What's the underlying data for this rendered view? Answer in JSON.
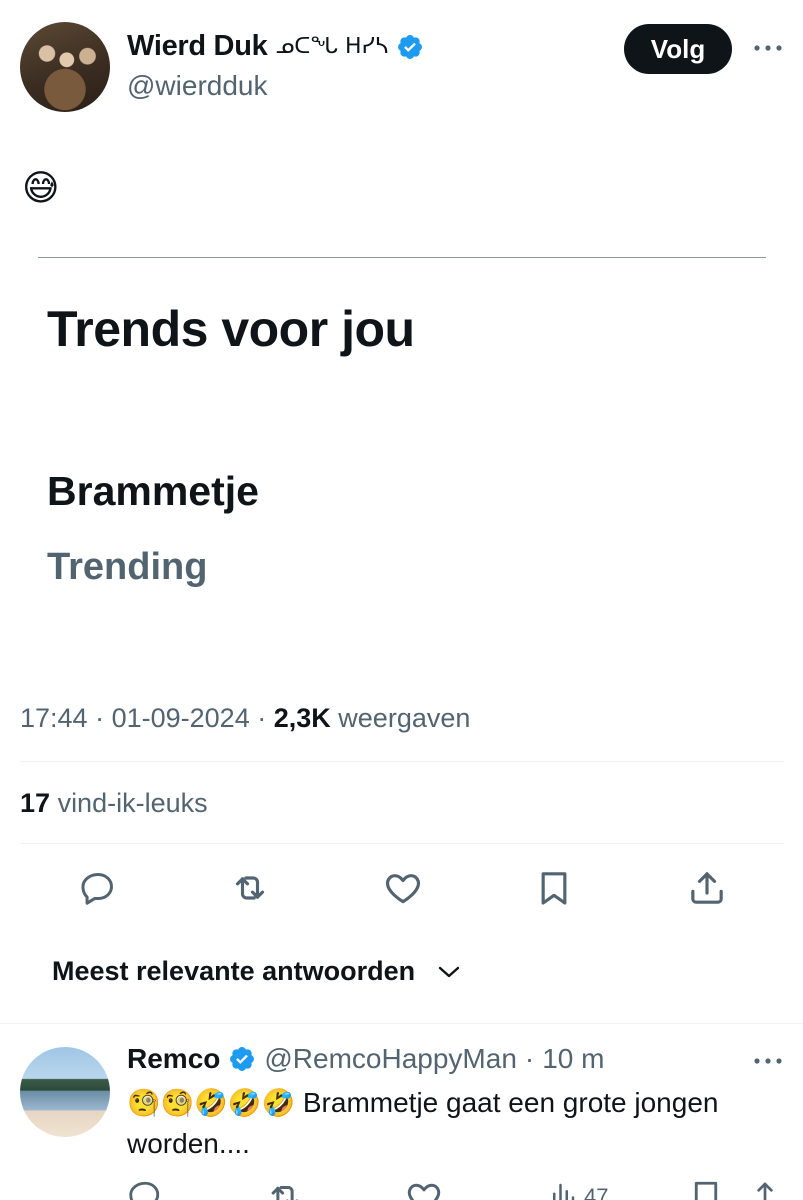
{
  "author": {
    "display_name": "Wierd Duk",
    "name_glyphs": "ᓄᑕᖓ ᕼᓯᓴ",
    "handle": "@wierdduk",
    "verified": true
  },
  "follow_label": "Volg",
  "tweet": {
    "text": "😅",
    "embed": {
      "title": "Trends voor jou",
      "trend_name": "Brammetje",
      "trend_status": "Trending"
    },
    "time": "17:44",
    "date": "01-09-2024",
    "views_count": "2,3K",
    "views_label": "weergaven",
    "likes_count": "17",
    "likes_label": "vind-ik-leuks"
  },
  "icons": {
    "reply": "reply-icon",
    "retweet": "retweet-icon",
    "like": "like-icon",
    "bookmark": "bookmark-icon",
    "share": "share-icon"
  },
  "sort": {
    "label": "Meest relevante antwoorden"
  },
  "reply": {
    "display_name": "Remco",
    "handle": "@RemcoHappyMan",
    "separator": "·",
    "time": "10 m",
    "emojis": "🧐🧐🤣🤣🤣",
    "text": "Brammetje gaat een grote jongen worden....",
    "views_count": "47"
  },
  "colors": {
    "text": "#0f1419",
    "secondary": "#536471",
    "verified_blue": "#1d9bf0",
    "button_bg": "#0f1419"
  }
}
